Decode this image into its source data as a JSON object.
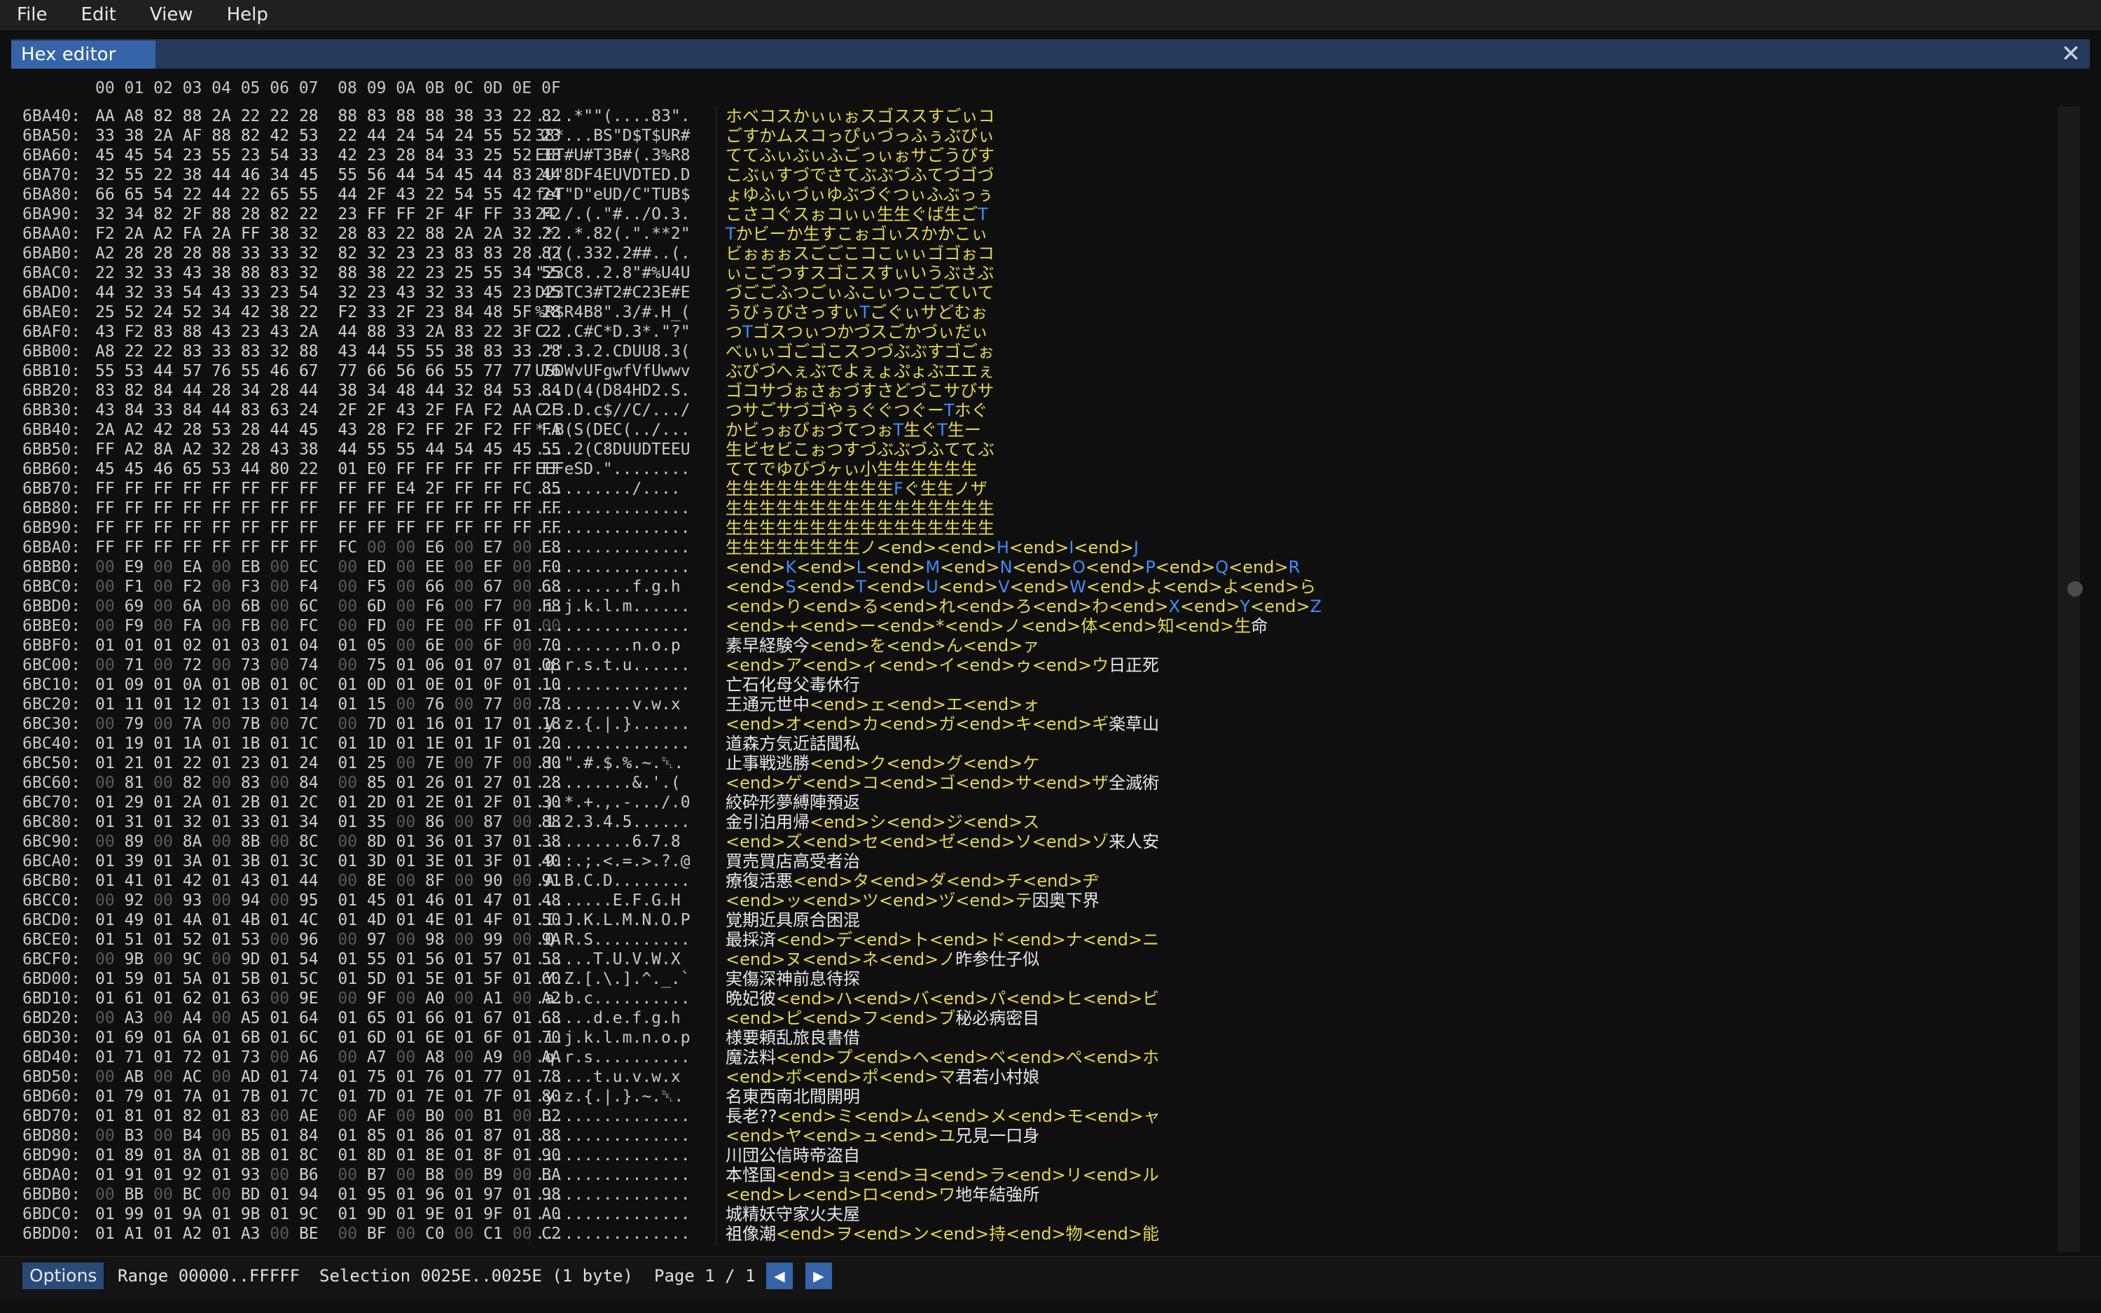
{
  "menubar": {
    "items": [
      "File",
      "Edit",
      "View",
      "Help"
    ]
  },
  "window": {
    "tab_label": "Hex editor",
    "close_glyph": "✕"
  },
  "column_header": "00 01 02 03 04 05 06 07  08 09 0A 0B 0C 0D 0E 0F",
  "rows": [
    {
      "addr": "6BA40:",
      "hex": "AA A8 82 88 2A 22 22 28  88 83 88 88 38 33 22 82",
      "ascii": "....*\"\"(....83\".",
      "chars": [
        [
          "y",
          "ホベコスかぃぃぉスゴススすごぃコ"
        ]
      ]
    },
    {
      "addr": "6BA50:",
      "hex": "33 38 2A AF 88 82 42 53  22 44 24 54 24 55 52 23",
      "ascii": "38*...BS\"D$T$UR#",
      "chars": [
        [
          "y",
          "ごすかムスコっぴぃづっふぅぶびぃ"
        ]
      ]
    },
    {
      "addr": "6BA60:",
      "hex": "45 45 54 23 55 23 54 33  42 23 28 84 33 25 52 38",
      "ascii": "EET#U#T3B#(.3%R8",
      "chars": [
        [
          "y",
          "ててふぃぶぃふごっぃぉサごうびす"
        ]
      ]
    },
    {
      "addr": "6BA70:",
      "hex": "32 55 22 38 44 46 34 45  55 56 44 54 45 44 83 44",
      "ascii": "2U\"8DF4EUVDTED.D",
      "chars": [
        [
          "y",
          "こぶぃすづでさてぶぶづふてづゴづ"
        ]
      ]
    },
    {
      "addr": "6BA80:",
      "hex": "66 65 54 22 44 22 65 55  44 2F 43 22 54 55 42 24",
      "ascii": "feT\"D\"eUD/C\"TUB$",
      "chars": [
        [
          "y",
          "ょゆふぃづぃゆぶづぐつぃふぶっぅ"
        ]
      ]
    },
    {
      "addr": "6BA90:",
      "hex": "32 34 82 2F 88 28 82 22  23 FF FF 2F 4F FF 33 F2",
      "ascii": "24./.(.\"#../O.3.",
      "chars": [
        [
          "y",
          "こさコぐスぉコぃぃ生生ぐば生ご"
        ],
        [
          "b",
          "T"
        ]
      ]
    },
    {
      "addr": "6BAA0:",
      "hex": "F2 2A A2 FA 2A FF 38 32  28 83 22 88 2A 2A 32 22",
      "ascii": ".*..*.82(.\".**2\"",
      "chars": [
        [
          "b",
          "T"
        ],
        [
          "y",
          "かビーか生すこぉゴぃスかかこぃ"
        ]
      ]
    },
    {
      "addr": "6BAB0:",
      "hex": "A2 28 28 28 88 33 33 32  82 32 23 23 83 83 28 82",
      "ascii": ".(((.332.2##..(.",
      "chars": [
        [
          "y",
          "ビぉぉぉスごごこコこぃぃゴゴぉコ"
        ]
      ]
    },
    {
      "addr": "6BAC0:",
      "hex": "22 32 33 43 38 88 83 32  88 38 22 23 25 55 34 55",
      "ascii": "\"23C8..2.8\"#%U4U",
      "chars": [
        [
          "y",
          "ぃこごつすスゴこスすぃいうぶさぶ"
        ]
      ]
    },
    {
      "addr": "6BAD0:",
      "hex": "44 32 33 54 43 33 23 54  32 23 43 32 33 45 23 45",
      "ascii": "D23TC3#T2#C23E#E",
      "chars": [
        [
          "y",
          "づごごふつごぃふこぃつこごていて"
        ]
      ]
    },
    {
      "addr": "6BAE0:",
      "hex": "25 52 24 52 34 42 38 22  F2 33 2F 23 84 48 5F 28",
      "ascii": "%R$R4B8\".3/#.H_(",
      "chars": [
        [
          "y",
          "うびぅびさっすぃ"
        ],
        [
          "b",
          "T"
        ],
        [
          "y",
          "ごぐぃサどむぉ"
        ]
      ]
    },
    {
      "addr": "6BAF0:",
      "hex": "43 F2 83 88 43 23 43 2A  44 88 33 2A 83 22 3F 22",
      "ascii": "C...C#C*D.3*.\"?\"",
      "chars": [
        [
          "y",
          "つ"
        ],
        [
          "b",
          "T"
        ],
        [
          "y",
          "ゴスつぃつかづスごかづぃだぃ"
        ]
      ]
    },
    {
      "addr": "6BB00:",
      "hex": "A8 22 22 83 33 83 32 88  43 44 55 55 38 83 33 28",
      "ascii": ".\"\".3.2.CDUU8.3(",
      "chars": [
        [
          "y",
          "べぃぃゴごゴこスつづぶぶすゴごぉ"
        ]
      ]
    },
    {
      "addr": "6BB10:",
      "hex": "55 53 44 57 76 55 46 67  77 66 56 66 55 77 77 76",
      "ascii": "USDWvUFgwfVfUwwv",
      "chars": [
        [
          "y",
          "ぶびづへぇぶでよぇょぷょぶエエぇ"
        ]
      ]
    },
    {
      "addr": "6BB20:",
      "hex": "83 82 84 44 28 34 28 44  38 34 48 44 32 84 53 84",
      "ascii": "...D(4(D84HD2.S.",
      "chars": [
        [
          "y",
          "ゴコサづぉさぉづすさどづこサびサ"
        ]
      ]
    },
    {
      "addr": "6BB30:",
      "hex": "43 84 33 84 44 83 63 24  2F 2F 43 2F FA F2 AA 2F",
      "ascii": "C.3.D.c$//C/.../",
      "chars": [
        [
          "y",
          "つサごサづゴやぅぐぐつぐー"
        ],
        [
          "b",
          "T"
        ],
        [
          "y",
          "ホぐ"
        ]
      ]
    },
    {
      "addr": "6BB40:",
      "hex": "2A A2 42 28 53 28 44 45  43 28 F2 FF 2F F2 FF FA",
      "ascii": "*.B(S(DEC(../...",
      "chars": [
        [
          "y",
          "かビっぉびぉづてつぉ"
        ],
        [
          "b",
          "T"
        ],
        [
          "y",
          "生ぐ"
        ],
        [
          "b",
          "T"
        ],
        [
          "y",
          "生ー"
        ]
      ]
    },
    {
      "addr": "6BB50:",
      "hex": "FF A2 8A A2 32 28 43 38  44 55 55 44 54 45 45 55",
      "ascii": "....2(C8DUUDTEEU",
      "chars": [
        [
          "y",
          "生ビセビこぉつすづぶぶづふててぶ"
        ]
      ]
    },
    {
      "addr": "6BB60:",
      "hex": "45 45 46 65 53 44 80 22  01 E0 FF FF FF FF FF FF",
      "ascii": "EEFeSD.\"........",
      "chars": [
        [
          "y",
          "ててでゆびづヶぃ小生生生生生生"
        ]
      ]
    },
    {
      "addr": "6BB70:",
      "hex": "FF FF FF FF FF FF FF FF  FF FF E4 2F FF FF FC 85",
      "ascii": "........../....",
      "chars": [
        [
          "y",
          "生生生生生生生生生生"
        ],
        [
          "b",
          "F"
        ],
        [
          "y",
          "ぐ生生ノザ"
        ]
      ]
    },
    {
      "addr": "6BB80:",
      "hex": "FF FF FF FF FF FF FF FF  FF FF FF FF FF FF FF FF",
      "ascii": "................",
      "chars": [
        [
          "y",
          "生生生生生生生生生生生生生生生生"
        ]
      ]
    },
    {
      "addr": "6BB90:",
      "hex": "FF FF FF FF FF FF FF FF  FF FF FF FF FF FF FF FF",
      "ascii": "................",
      "chars": [
        [
          "y",
          "生生生生生生生生生生生生生生生生"
        ]
      ]
    },
    {
      "addr": "6BBA0:",
      "hex": "FF FF FF FF FF FF FF FF  FC 00 00 E6 00 E7 00 E8",
      "ascii": "................",
      "chars": [
        [
          "y",
          "生生生生生生生生ノ<end><end>"
        ],
        [
          "b",
          "H"
        ],
        [
          "y",
          "<end>"
        ],
        [
          "b",
          "I"
        ],
        [
          "y",
          "<end>"
        ],
        [
          "b",
          "J"
        ]
      ]
    },
    {
      "addr": "6BBB0:",
      "hex": "00 E9 00 EA 00 EB 00 EC  00 ED 00 EE 00 EF 00 F0",
      "ascii": "................",
      "chars": [
        [
          "y",
          "<end>"
        ],
        [
          "b",
          "K"
        ],
        [
          "y",
          "<end>"
        ],
        [
          "b",
          "L"
        ],
        [
          "y",
          "<end>"
        ],
        [
          "b",
          "M"
        ],
        [
          "y",
          "<end>"
        ],
        [
          "b",
          "N"
        ],
        [
          "y",
          "<end>"
        ],
        [
          "b",
          "O"
        ],
        [
          "y",
          "<end>"
        ],
        [
          "b",
          "P"
        ],
        [
          "y",
          "<end>"
        ],
        [
          "b",
          "Q"
        ],
        [
          "y",
          "<end>"
        ],
        [
          "b",
          "R"
        ]
      ]
    },
    {
      "addr": "6BBC0:",
      "hex": "00 F1 00 F2 00 F3 00 F4  00 F5 00 66 00 67 00 68",
      "ascii": "..........f.g.h",
      "chars": [
        [
          "y",
          "<end>"
        ],
        [
          "b",
          "S"
        ],
        [
          "y",
          "<end>"
        ],
        [
          "b",
          "T"
        ],
        [
          "y",
          "<end>"
        ],
        [
          "b",
          "U"
        ],
        [
          "y",
          "<end>"
        ],
        [
          "b",
          "V"
        ],
        [
          "y",
          "<end>"
        ],
        [
          "b",
          "W"
        ],
        [
          "y",
          "<end>よ<end>よ<end>ら"
        ]
      ]
    },
    {
      "addr": "6BBD0:",
      "hex": "00 69 00 6A 00 6B 00 6C  00 6D 00 F6 00 F7 00 F8",
      "ascii": ".i.j.k.l.m......",
      "chars": [
        [
          "y",
          "<end>り<end>る<end>れ<end>ろ<end>わ<end>"
        ],
        [
          "b",
          "X"
        ],
        [
          "y",
          "<end>"
        ],
        [
          "b",
          "Y"
        ],
        [
          "y",
          "<end>"
        ],
        [
          "b",
          "Z"
        ]
      ]
    },
    {
      "addr": "6BBE0:",
      "hex": "00 F9 00 FA 00 FB 00 FC  00 FD 00 FE 00 FF 01 00",
      "ascii": "................",
      "chars": [
        [
          "y",
          "<end>+<end>ー<end>*<end>ノ<end>体<end>知<end>生"
        ],
        [
          "w",
          "命"
        ]
      ]
    },
    {
      "addr": "6BBF0:",
      "hex": "01 01 01 02 01 03 01 04  01 05 00 6E 00 6F 00 70",
      "ascii": "..........n.o.p",
      "chars": [
        [
          "w",
          "素早経験今"
        ],
        [
          "y",
          "<end>を<end>ん<end>ァ"
        ]
      ]
    },
    {
      "addr": "6BC00:",
      "hex": "00 71 00 72 00 73 00 74  00 75 01 06 01 07 01 08",
      "ascii": ".q.r.s.t.u......",
      "chars": [
        [
          "y",
          "<end>ア<end>ィ<end>イ<end>ゥ<end>ウ"
        ],
        [
          "w",
          "日正死"
        ]
      ]
    },
    {
      "addr": "6BC10:",
      "hex": "01 09 01 0A 01 0B 01 0C  01 0D 01 0E 01 0F 01 10",
      "ascii": "................",
      "chars": [
        [
          "w",
          "亡石化母父毒休行"
        ]
      ]
    },
    {
      "addr": "6BC20:",
      "hex": "01 11 01 12 01 13 01 14  01 15 00 76 00 77 00 78",
      "ascii": "..........v.w.x",
      "chars": [
        [
          "w",
          "王通元世中"
        ],
        [
          "y",
          "<end>ェ<end>エ<end>ォ"
        ]
      ]
    },
    {
      "addr": "6BC30:",
      "hex": "00 79 00 7A 00 7B 00 7C  00 7D 01 16 01 17 01 18",
      "ascii": ".y.z.{.|.}......",
      "chars": [
        [
          "y",
          "<end>オ<end>カ<end>ガ<end>キ<end>ギ"
        ],
        [
          "w",
          "楽草山"
        ]
      ]
    },
    {
      "addr": "6BC40:",
      "hex": "01 19 01 1A 01 1B 01 1C  01 1D 01 1E 01 1F 01 20",
      "ascii": "................",
      "chars": [
        [
          "w",
          "道森方気近話聞私"
        ]
      ]
    },
    {
      "addr": "6BC50:",
      "hex": "01 21 01 22 01 23 01 24  01 25 00 7E 00 7F 00 80",
      "ascii": ".!.\".#.$.%.~.␡.",
      "chars": [
        [
          "w",
          "止事戦逃勝"
        ],
        [
          "y",
          "<end>ク<end>グ<end>ケ"
        ]
      ]
    },
    {
      "addr": "6BC60:",
      "hex": "00 81 00 82 00 83 00 84  00 85 01 26 01 27 01 28",
      "ascii": "..........&.'.(",
      "chars": [
        [
          "y",
          "<end>ゲ<end>コ<end>ゴ<end>サ<end>ザ"
        ],
        [
          "w",
          "全滅術"
        ]
      ]
    },
    {
      "addr": "6BC70:",
      "hex": "01 29 01 2A 01 2B 01 2C  01 2D 01 2E 01 2F 01 30",
      "ascii": ".).*.+.,.-.../.0",
      "chars": [
        [
          "w",
          "絞砕形夢縛陣預返"
        ]
      ]
    },
    {
      "addr": "6BC80:",
      "hex": "01 31 01 32 01 33 01 34  01 35 00 86 00 87 00 88",
      "ascii": ".1.2.3.4.5......",
      "chars": [
        [
          "w",
          "金引泊用帰"
        ],
        [
          "y",
          "<end>シ<end>ジ<end>ス"
        ]
      ]
    },
    {
      "addr": "6BC90:",
      "hex": "00 89 00 8A 00 8B 00 8C  00 8D 01 36 01 37 01 38",
      "ascii": "..........6.7.8",
      "chars": [
        [
          "y",
          "<end>ズ<end>セ<end>ゼ<end>ソ<end>ゾ"
        ],
        [
          "w",
          "来人安"
        ]
      ]
    },
    {
      "addr": "6BCA0:",
      "hex": "01 39 01 3A 01 3B 01 3C  01 3D 01 3E 01 3F 01 40",
      "ascii": ".9.:.;.<.=.>.?.@",
      "chars": [
        [
          "w",
          "買売買店高受者治"
        ]
      ]
    },
    {
      "addr": "6BCB0:",
      "hex": "01 41 01 42 01 43 01 44  00 8E 00 8F 00 90 00 91",
      "ascii": ".A.B.C.D........",
      "chars": [
        [
          "w",
          "療復活悪"
        ],
        [
          "y",
          "<end>タ<end>ダ<end>チ<end>ヂ"
        ]
      ]
    },
    {
      "addr": "6BCC0:",
      "hex": "00 92 00 93 00 94 00 95  01 45 01 46 01 47 01 48",
      "ascii": "........E.F.G.H",
      "chars": [
        [
          "y",
          "<end>ッ<end>ツ<end>ヅ<end>テ"
        ],
        [
          "w",
          "因奥下界"
        ]
      ]
    },
    {
      "addr": "6BCD0:",
      "hex": "01 49 01 4A 01 4B 01 4C  01 4D 01 4E 01 4F 01 50",
      "ascii": ".I.J.K.L.M.N.O.P",
      "chars": [
        [
          "w",
          "覚期近具原合困混"
        ]
      ]
    },
    {
      "addr": "6BCE0:",
      "hex": "01 51 01 52 01 53 00 96  00 97 00 98 00 99 00 9A",
      "ascii": ".Q.R.S..........",
      "chars": [
        [
          "w",
          "最採済"
        ],
        [
          "y",
          "<end>デ<end>ト<end>ド<end>ナ<end>ニ"
        ]
      ]
    },
    {
      "addr": "6BCF0:",
      "hex": "00 9B 00 9C 00 9D 01 54  01 55 01 56 01 57 01 58",
      "ascii": "......T.U.V.W.X",
      "chars": [
        [
          "y",
          "<end>ヌ<end>ネ<end>ノ"
        ],
        [
          "w",
          "昨参仕子似"
        ]
      ]
    },
    {
      "addr": "6BD00:",
      "hex": "01 59 01 5A 01 5B 01 5C  01 5D 01 5E 01 5F 01 60",
      "ascii": ".Y.Z.[.\\.].^._.`",
      "chars": [
        [
          "w",
          "実傷深神前息待探"
        ]
      ]
    },
    {
      "addr": "6BD10:",
      "hex": "01 61 01 62 01 63 00 9E  00 9F 00 A0 00 A1 00 A2",
      "ascii": ".a.b.c..........",
      "chars": [
        [
          "w",
          "晩妃彼"
        ],
        [
          "y",
          "<end>ハ<end>バ<end>パ<end>ヒ<end>ビ"
        ]
      ]
    },
    {
      "addr": "6BD20:",
      "hex": "00 A3 00 A4 00 A5 01 64  01 65 01 66 01 67 01 68",
      "ascii": "......d.e.f.g.h",
      "chars": [
        [
          "y",
          "<end>ピ<end>フ<end>ブ"
        ],
        [
          "w",
          "秘必病密目"
        ]
      ]
    },
    {
      "addr": "6BD30:",
      "hex": "01 69 01 6A 01 6B 01 6C  01 6D 01 6E 01 6F 01 70",
      "ascii": ".i.j.k.l.m.n.o.p",
      "chars": [
        [
          "w",
          "様要頼乱旅良書借"
        ]
      ]
    },
    {
      "addr": "6BD40:",
      "hex": "01 71 01 72 01 73 00 A6  00 A7 00 A8 00 A9 00 AA",
      "ascii": ".q.r.s..........",
      "chars": [
        [
          "w",
          "魔法料"
        ],
        [
          "y",
          "<end>プ<end>ヘ<end>ベ<end>ペ<end>ホ"
        ]
      ]
    },
    {
      "addr": "6BD50:",
      "hex": "00 AB 00 AC 00 AD 01 74  01 75 01 76 01 77 01 78",
      "ascii": "......t.u.v.w.x",
      "chars": [
        [
          "y",
          "<end>ボ<end>ポ<end>マ"
        ],
        [
          "w",
          "君若小村娘"
        ]
      ]
    },
    {
      "addr": "6BD60:",
      "hex": "01 79 01 7A 01 7B 01 7C  01 7D 01 7E 01 7F 01 80",
      "ascii": ".y.z.{.|.}.~.␡.",
      "chars": [
        [
          "w",
          "名東西南北間開明"
        ]
      ]
    },
    {
      "addr": "6BD70:",
      "hex": "01 81 01 82 01 83 00 AE  00 AF 00 B0 00 B1 00 B2",
      "ascii": "................",
      "chars": [
        [
          "w",
          "長老??"
        ],
        [
          "y",
          "<end>ミ<end>ム<end>メ<end>モ<end>ャ"
        ]
      ]
    },
    {
      "addr": "6BD80:",
      "hex": "00 B3 00 B4 00 B5 01 84  01 85 01 86 01 87 01 88",
      "ascii": "................",
      "chars": [
        [
          "y",
          "<end>ヤ<end>ュ<end>ユ"
        ],
        [
          "w",
          "兄見一口身"
        ]
      ]
    },
    {
      "addr": "6BD90:",
      "hex": "01 89 01 8A 01 8B 01 8C  01 8D 01 8E 01 8F 01 90",
      "ascii": "................",
      "chars": [
        [
          "w",
          "川団公信時帝盗自"
        ]
      ]
    },
    {
      "addr": "6BDA0:",
      "hex": "01 91 01 92 01 93 00 B6  00 B7 00 B8 00 B9 00 BA",
      "ascii": "................",
      "chars": [
        [
          "w",
          "本怪国"
        ],
        [
          "y",
          "<end>ョ<end>ヨ<end>ラ<end>リ<end>ル"
        ]
      ]
    },
    {
      "addr": "6BDB0:",
      "hex": "00 BB 00 BC 00 BD 01 94  01 95 01 96 01 97 01 98",
      "ascii": "................",
      "chars": [
        [
          "y",
          "<end>レ<end>ロ<end>ワ"
        ],
        [
          "w",
          "地年結強所"
        ]
      ]
    },
    {
      "addr": "6BDC0:",
      "hex": "01 99 01 9A 01 9B 01 9C  01 9D 01 9E 01 9F 01 A0",
      "ascii": "................",
      "chars": [
        [
          "w",
          "城精妖守家火夫屋"
        ]
      ]
    },
    {
      "addr": "6BDD0:",
      "hex": "01 A1 01 A2 01 A3 00 BE  00 BF 00 C0 00 C1 00 C2",
      "ascii": "................",
      "chars": [
        [
          "w",
          "祖像潮"
        ],
        [
          "y",
          "<end>ヲ<end>ン<end>持<end>物<end>能"
        ]
      ]
    }
  ],
  "statusbar": {
    "options_label": "Options",
    "range_text": "Range 00000..FFFFF",
    "selection_text": "Selection 0025E..0025E (1 byte)",
    "page_text": "Page 1 / 1",
    "prev_glyph": "◀",
    "next_glyph": "▶"
  },
  "colors": {
    "accent": "#3565a8",
    "highlight_text": "#e8d84a",
    "control_text": "#3f8cff"
  },
  "icons": [
    "close-icon",
    "arrow-left-icon",
    "arrow-right-icon"
  ]
}
